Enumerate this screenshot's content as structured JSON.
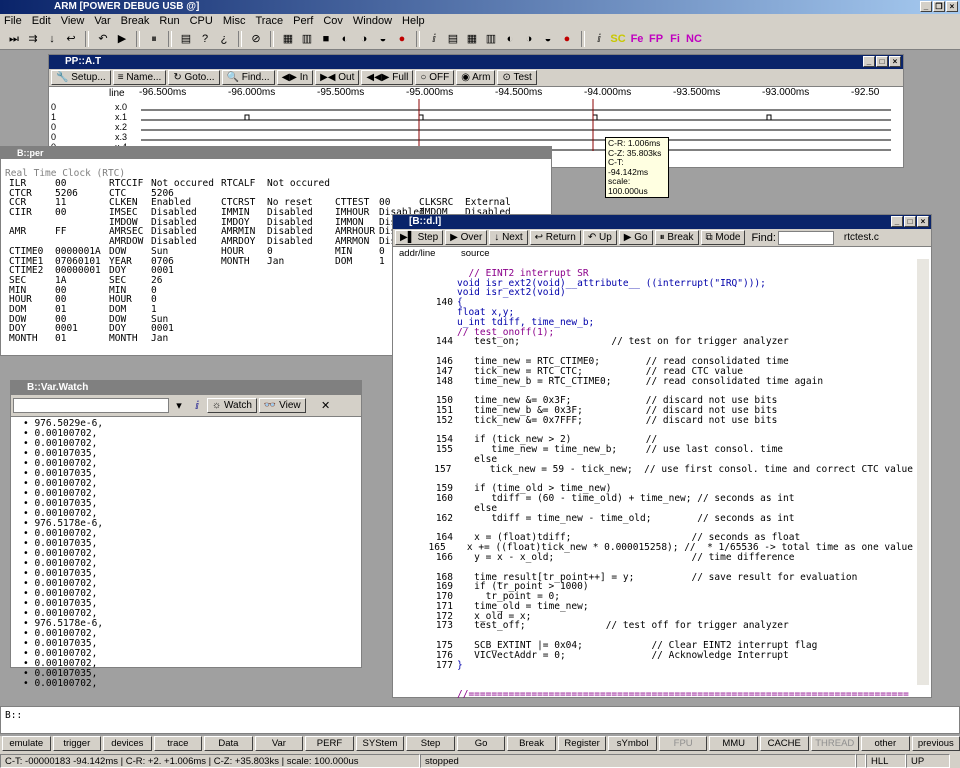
{
  "app": {
    "title": "ARM [POWER DEBUG USB @]"
  },
  "menu": [
    "File",
    "Edit",
    "View",
    "Var",
    "Break",
    "Run",
    "CPU",
    "Misc",
    "Trace",
    "Perf",
    "Cov",
    "Window",
    "Help"
  ],
  "toolbar_icons": [
    "step-icon",
    "step-over-icon",
    "down-icon",
    "return-icon",
    "undo-icon",
    "go-icon",
    "break-icon",
    "trace-icon",
    "help-icon",
    "help-context-icon",
    "stop-icon",
    "list-icon",
    "register-icon",
    "memory-icon",
    "watch-icon",
    "watch2-icon",
    "watch3-icon",
    "breakpoint-icon",
    "var-icon",
    "list2-icon",
    "register2-icon",
    "memory2-icon",
    "perf-icon",
    "perf2-icon",
    "perf3-icon",
    "breakpoint2-icon",
    "var2-icon",
    "sc-icon",
    "fe-icon",
    "fp-icon",
    "fi-icon",
    "nc-icon"
  ],
  "pp_window": {
    "title": "PP::A.T",
    "buttons": [
      "Setup...",
      "Name...",
      "Goto...",
      "Find...",
      "In",
      "Out",
      "Full",
      "OFF",
      "Arm",
      "Test"
    ],
    "column_label": "line",
    "ruler": [
      "-96.500ms",
      "-96.000ms",
      "-95.500ms",
      "-95.000ms",
      "-94.500ms",
      "-94.000ms",
      "-93.500ms",
      "-93.000ms",
      "-92.50"
    ],
    "channels": [
      {
        "val": "0",
        "name": "x.0"
      },
      {
        "val": "1",
        "name": "x.1"
      },
      {
        "val": "0",
        "name": "x.2"
      },
      {
        "val": "0",
        "name": "x.3"
      },
      {
        "val": "0",
        "name": "x.4"
      }
    ],
    "tooltip": [
      "C-R:   1.006ms",
      "C-Z:  35.803ks",
      "C-T: -94.142ms",
      "scale: 100.000us"
    ]
  },
  "rtc_window": {
    "title": "B::per",
    "header": "Real Time Clock (RTC)",
    "rows": [
      [
        "ILR",
        "00",
        "RTCCIF",
        "Not occured",
        "RTCALF",
        "Not occured",
        "",
        "",
        "",
        ""
      ],
      [
        "CTCR",
        "5206",
        "CTC",
        "5206",
        "",
        "",
        "",
        "",
        "",
        ""
      ],
      [
        "CCR",
        "11",
        "CLKEN",
        "Enabled",
        "CTCRST",
        "No reset",
        "CTTEST",
        "00",
        "CLKSRC",
        "External"
      ],
      [
        "CIIR",
        "00",
        "IMSEC",
        "Disabled",
        "IMMIN",
        "Disabled",
        "IMHOUR",
        "Disabled",
        "IMDOM",
        "Disabled"
      ],
      [
        "",
        "",
        "IMDOW",
        "Disabled",
        "IMDOY",
        "Disabled",
        "IMMON",
        "Disabl",
        "",
        ""
      ],
      [
        "AMR",
        "FF",
        "AMRSEC",
        "Disabled",
        "AMRMIN",
        "Disabled",
        "AMRHOUR",
        "Disabl",
        "",
        ""
      ],
      [
        "",
        "",
        "AMRDOW",
        "Disabled",
        "AMRDOY",
        "Disabled",
        "AMRMON",
        "Disabl",
        "",
        ""
      ],
      [
        "CTIME0",
        "0000001A",
        "DOW",
        "Sun",
        "HOUR",
        "0",
        "MIN",
        "0",
        "",
        ""
      ],
      [
        "CTIME1",
        "07060101",
        "YEAR",
        "0706",
        "MONTH",
        "Jan",
        "DOM",
        "1",
        "",
        ""
      ],
      [
        "CTIME2",
        "00000001",
        "DOY",
        "0001",
        "",
        "",
        "",
        "",
        "",
        ""
      ],
      [
        "SEC",
        "1A",
        "SEC",
        "26",
        "",
        "",
        "",
        "",
        "",
        ""
      ],
      [
        "MIN",
        "00",
        "MIN",
        "0",
        "",
        "",
        "",
        "",
        "",
        ""
      ],
      [
        "HOUR",
        "00",
        "HOUR",
        "0",
        "",
        "",
        "",
        "",
        "",
        ""
      ],
      [
        "DOM",
        "01",
        "DOM",
        "1",
        "",
        "",
        "",
        "",
        "",
        ""
      ],
      [
        "DOW",
        "00",
        "DOW",
        "Sun",
        "",
        "",
        "",
        "",
        "",
        ""
      ],
      [
        "DOY",
        "0001",
        "DOY",
        "0001",
        "",
        "",
        "",
        "",
        "",
        ""
      ],
      [
        "MONTH",
        "01",
        "MONTH",
        "Jan",
        "",
        "",
        "",
        "",
        "",
        ""
      ]
    ]
  },
  "watch_window": {
    "title": "B::Var.Watch",
    "watch_label": "Watch",
    "view_label": "View",
    "values": [
      "976.5029e-6,",
      "0.00100702,",
      "0.00100702,",
      "0.00107035,",
      "0.00100702,",
      "0.00107035,",
      "0.00100702,",
      "0.00100702,",
      "0.00107035,",
      "0.00100702,",
      "976.5178e-6,",
      "0.00100702,",
      "0.00107035,",
      "0.00100702,",
      "0.00100702,",
      "0.00107035,",
      "0.00100702,",
      "0.00100702,",
      "0.00107035,",
      "0.00100702,",
      "976.5178e-6,",
      "0.00100702,",
      "0.00107035,",
      "0.00100702,",
      "0.00100702,",
      "0.00107035,",
      "0.00100702,"
    ]
  },
  "src_window": {
    "title": "[B::d.l]",
    "buttons": [
      "Step",
      "Over",
      "Next",
      "Return",
      "Up",
      "Go",
      "Break",
      "Mode"
    ],
    "find_label": "Find:",
    "file": "rtctest.c",
    "col_addr": "addr/line",
    "col_source": "source",
    "lines": [
      {
        "n": "",
        "t": "",
        "c": ""
      },
      {
        "n": "",
        "t": "  // EINT2 interrupt SR",
        "c": "cm"
      },
      {
        "n": "",
        "t": "void isr_ext2(void)__attribute__ ((interrupt(\"IRQ\")));",
        "c": "kw"
      },
      {
        "n": "",
        "t": "void isr_ext2(void)",
        "c": "kw"
      },
      {
        "n": "140",
        "t": "{",
        "c": "kw"
      },
      {
        "n": "",
        "t": "float x,y;",
        "c": "kw"
      },
      {
        "n": "",
        "t": "u_int tdiff, time_new_b;",
        "c": "kw"
      },
      {
        "n": "",
        "t": "// test_onoff(1);",
        "c": "cm"
      },
      {
        "n": "144",
        "t": "   test_on;                // test on for trigger analyzer",
        "c": ""
      },
      {
        "n": "",
        "t": "",
        "c": ""
      },
      {
        "n": "146",
        "t": "   time_new = RTC_CTIME0;        // read consolidated time",
        "c": ""
      },
      {
        "n": "147",
        "t": "   tick_new = RTC_CTC;           // read CTC value",
        "c": ""
      },
      {
        "n": "148",
        "t": "   time_new_b = RTC_CTIME0;      // read consolidated time again",
        "c": ""
      },
      {
        "n": "",
        "t": "",
        "c": ""
      },
      {
        "n": "150",
        "t": "   time_new &= 0x3F;             // discard not use bits",
        "c": ""
      },
      {
        "n": "151",
        "t": "   time_new_b &= 0x3F;           // discard not use bits",
        "c": ""
      },
      {
        "n": "152",
        "t": "   tick_new &= 0x7FFF;           // discard not use bits",
        "c": ""
      },
      {
        "n": "",
        "t": "",
        "c": ""
      },
      {
        "n": "154",
        "t": "   if (tick_new > 2)             //",
        "c": ""
      },
      {
        "n": "155",
        "t": "      time_new = time_new_b;     // use last consol. time",
        "c": ""
      },
      {
        "n": "",
        "t": "   else",
        "c": ""
      },
      {
        "n": "157",
        "t": "      tick_new = 59 - tick_new;  // use first consol. time and correct CTC value",
        "c": ""
      },
      {
        "n": "",
        "t": "",
        "c": ""
      },
      {
        "n": "159",
        "t": "   if (time_old > time_new)",
        "c": ""
      },
      {
        "n": "160",
        "t": "      tdiff = (60 - time_old) + time_new; // seconds as int",
        "c": ""
      },
      {
        "n": "",
        "t": "   else",
        "c": ""
      },
      {
        "n": "162",
        "t": "      tdiff = time_new - time_old;        // seconds as int",
        "c": ""
      },
      {
        "n": "",
        "t": "",
        "c": ""
      },
      {
        "n": "164",
        "t": "   x = (float)tdiff;                     // seconds as float",
        "c": ""
      },
      {
        "n": "165",
        "t": "   x += ((float)tick_new * 0.000015258); //  * 1/65536 -> total time as one value",
        "c": ""
      },
      {
        "n": "166",
        "t": "   y = x - x_old;                        // time difference",
        "c": ""
      },
      {
        "n": "",
        "t": "",
        "c": ""
      },
      {
        "n": "168",
        "t": "   time_result[tr_point++] = y;          // save result for evaluation",
        "c": ""
      },
      {
        "n": "169",
        "t": "   if (tr_point > 1000)",
        "c": ""
      },
      {
        "n": "170",
        "t": "     tr_point = 0;",
        "c": ""
      },
      {
        "n": "171",
        "t": "   time_old = time_new;",
        "c": ""
      },
      {
        "n": "172",
        "t": "   x_old = x;",
        "c": ""
      },
      {
        "n": "173",
        "t": "   test_off;              // test off for trigger analyzer",
        "c": ""
      },
      {
        "n": "",
        "t": "",
        "c": ""
      },
      {
        "n": "175",
        "t": "   SCB_EXTINT |= 0x04;            // Clear EINT2 interrupt flag",
        "c": ""
      },
      {
        "n": "176",
        "t": "   VICVectAddr = 0;               // Acknowledge Interrupt",
        "c": ""
      },
      {
        "n": "177",
        "t": "}",
        "c": "kw"
      },
      {
        "n": "",
        "t": "",
        "c": ""
      },
      {
        "n": "",
        "t": "",
        "c": ""
      },
      {
        "n": "",
        "t": "//=============================================================================",
        "c": "cm"
      }
    ]
  },
  "cmdline": {
    "prompt": "B::"
  },
  "softkeys": [
    {
      "l": "emulate",
      "d": false
    },
    {
      "l": "trigger",
      "d": false
    },
    {
      "l": "devices",
      "d": false
    },
    {
      "l": "trace",
      "d": false
    },
    {
      "l": "Data",
      "d": false
    },
    {
      "l": "Var",
      "d": false
    },
    {
      "l": "PERF",
      "d": false
    },
    {
      "l": "SYStem",
      "d": false
    },
    {
      "l": "Step",
      "d": false
    },
    {
      "l": "Go",
      "d": false
    },
    {
      "l": "Break",
      "d": false
    },
    {
      "l": "Register",
      "d": false
    },
    {
      "l": "sYmbol",
      "d": false
    },
    {
      "l": "FPU",
      "d": true
    },
    {
      "l": "MMU",
      "d": false
    },
    {
      "l": "CACHE",
      "d": false
    },
    {
      "l": "THREAD",
      "d": true
    },
    {
      "l": "other",
      "d": false
    },
    {
      "l": "previous",
      "d": false
    }
  ],
  "status": [
    "C-T: -00000183  -94.142ms  | C-R: +2.  +1.006ms | C-Z: +35.803ks | scale: 100.000us",
    "stopped",
    "",
    "HLL",
    "UP"
  ]
}
